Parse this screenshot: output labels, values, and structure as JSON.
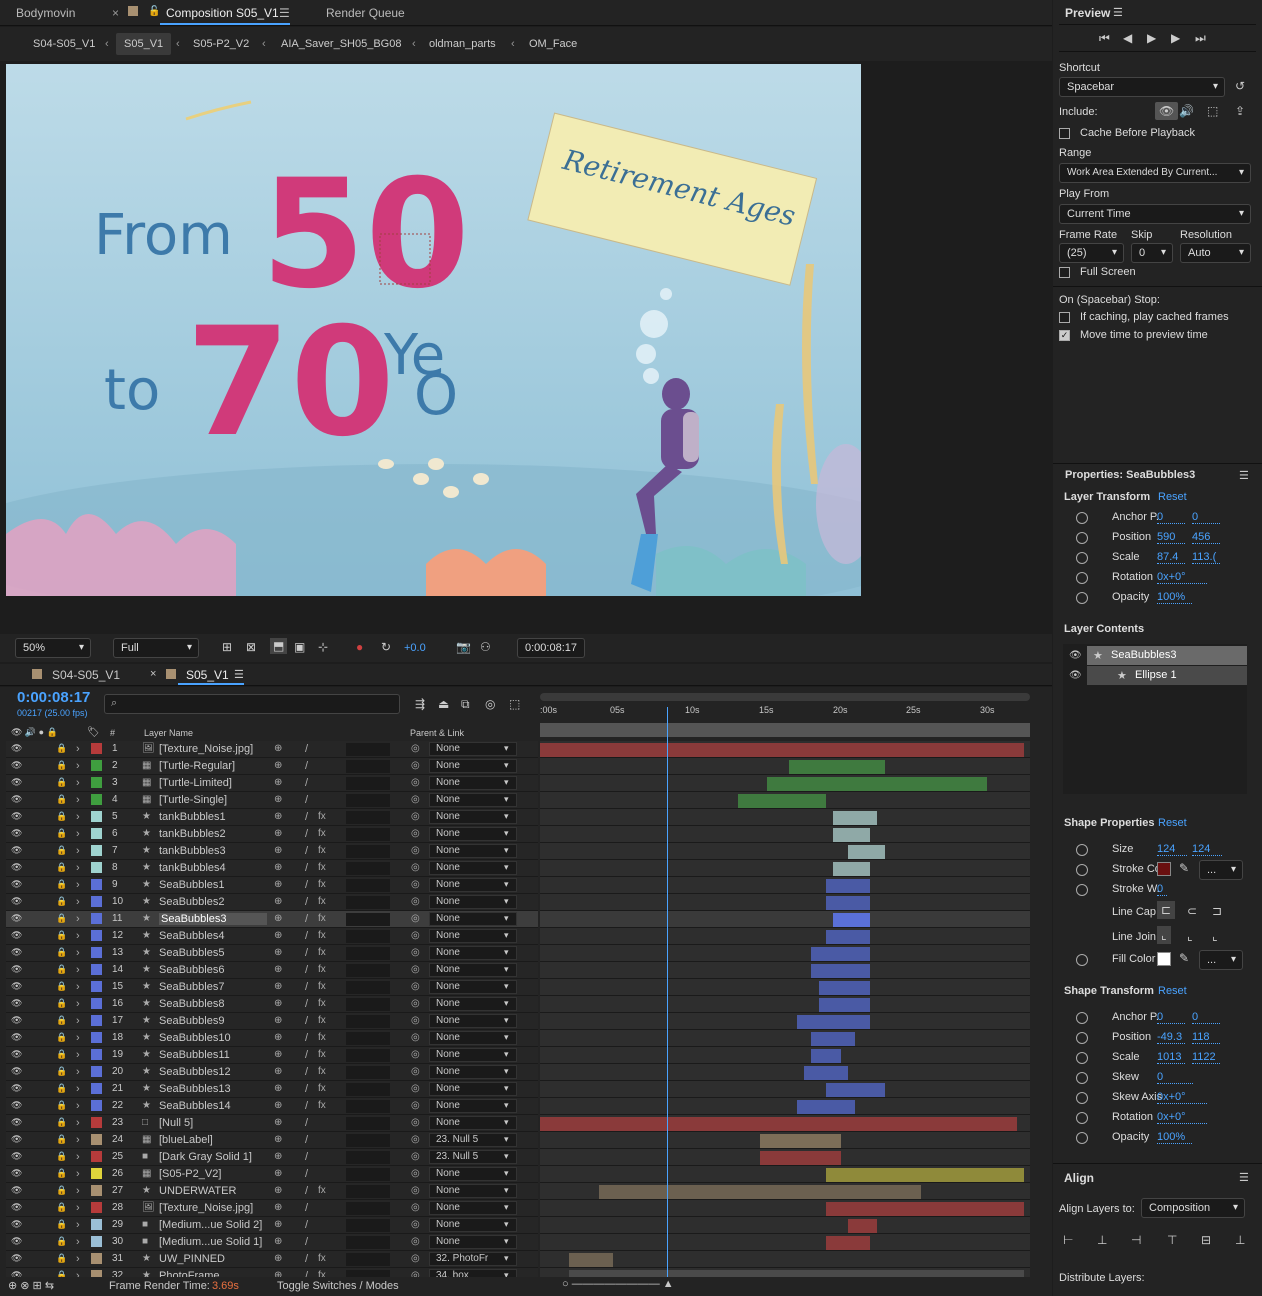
{
  "tabs": {
    "bodymovin": "Bodymovin",
    "close": "×",
    "composition": "Composition S05_V1",
    "menu": "☰",
    "render_queue": "Render Queue"
  },
  "breadcrumbs": [
    "S04-S05_V1",
    "S05_V1",
    "S05-P2_V2",
    "AIA_Saver_SH05_BG08",
    "oldman_parts",
    "OM_Face"
  ],
  "viewer": {
    "from": "From",
    "to": "to",
    "fifty": "50",
    "seventy": "70",
    "ye": "Ye",
    "o": "O",
    "sign": "Retirement Ages"
  },
  "viewer_bar": {
    "zoom": "50%",
    "quality": "Full",
    "exposure": "+0.0",
    "timecode": "0:00:08:17"
  },
  "timeline_tabs": {
    "tab1": "S04-S05_V1",
    "tab2": "S05_V1",
    "close": "×",
    "menu": "☰"
  },
  "timeline": {
    "time": "0:00:08:17",
    "frames": "00217 (25.00 fps)",
    "search_placeholder": "",
    "col_hash": "#",
    "col_layer": "Layer Name",
    "col_parent": "Parent & Link",
    "ticks": [
      ":00s",
      "05s",
      "10s",
      "15s",
      "20s",
      "25s",
      "30s"
    ],
    "frame_render_label": "Frame Render Time:",
    "frame_render_value": "3.69s",
    "toggle": "Toggle Switches / Modes"
  },
  "layers": [
    {
      "n": "1",
      "name": "[Texture_Noise.jpg]",
      "color": "#b63b3b",
      "parent": "None",
      "type": "img"
    },
    {
      "n": "2",
      "name": "[Turtle-Regular]",
      "color": "#3f9e3f",
      "parent": "None",
      "type": "comp"
    },
    {
      "n": "3",
      "name": "[Turtle-Limited]",
      "color": "#3f9e3f",
      "parent": "None",
      "type": "comp"
    },
    {
      "n": "4",
      "name": "[Turtle-Single]",
      "color": "#3f9e3f",
      "parent": "None",
      "type": "comp"
    },
    {
      "n": "5",
      "name": "tankBubbles1",
      "color": "#9fd3cf",
      "parent": "None",
      "type": "shape"
    },
    {
      "n": "6",
      "name": "tankBubbles2",
      "color": "#9fd3cf",
      "parent": "None",
      "type": "shape"
    },
    {
      "n": "7",
      "name": "tankBubbles3",
      "color": "#9fd3cf",
      "parent": "None",
      "type": "shape"
    },
    {
      "n": "8",
      "name": "tankBubbles4",
      "color": "#9fd3cf",
      "parent": "None",
      "type": "shape"
    },
    {
      "n": "9",
      "name": "SeaBubbles1",
      "color": "#5b6fd6",
      "parent": "None",
      "type": "shape"
    },
    {
      "n": "10",
      "name": "SeaBubbles2",
      "color": "#5b6fd6",
      "parent": "None",
      "type": "shape"
    },
    {
      "n": "11",
      "name": "SeaBubbles3",
      "color": "#5b6fd6",
      "parent": "None",
      "type": "shape"
    },
    {
      "n": "12",
      "name": "SeaBubbles4",
      "color": "#5b6fd6",
      "parent": "None",
      "type": "shape"
    },
    {
      "n": "13",
      "name": "SeaBubbles5",
      "color": "#5b6fd6",
      "parent": "None",
      "type": "shape"
    },
    {
      "n": "14",
      "name": "SeaBubbles6",
      "color": "#5b6fd6",
      "parent": "None",
      "type": "shape"
    },
    {
      "n": "15",
      "name": "SeaBubbles7",
      "color": "#5b6fd6",
      "parent": "None",
      "type": "shape"
    },
    {
      "n": "16",
      "name": "SeaBubbles8",
      "color": "#5b6fd6",
      "parent": "None",
      "type": "shape"
    },
    {
      "n": "17",
      "name": "SeaBubbles9",
      "color": "#5b6fd6",
      "parent": "None",
      "type": "shape"
    },
    {
      "n": "18",
      "name": "SeaBubbles10",
      "color": "#5b6fd6",
      "parent": "None",
      "type": "shape"
    },
    {
      "n": "19",
      "name": "SeaBubbles11",
      "color": "#5b6fd6",
      "parent": "None",
      "type": "shape"
    },
    {
      "n": "20",
      "name": "SeaBubbles12",
      "color": "#5b6fd6",
      "parent": "None",
      "type": "shape"
    },
    {
      "n": "21",
      "name": "SeaBubbles13",
      "color": "#5b6fd6",
      "parent": "None",
      "type": "shape"
    },
    {
      "n": "22",
      "name": "SeaBubbles14",
      "color": "#5b6fd6",
      "parent": "None",
      "type": "shape"
    },
    {
      "n": "23",
      "name": "[Null 5]",
      "color": "#b63b3b",
      "parent": "None",
      "type": "null"
    },
    {
      "n": "24",
      "name": "[blueLabel]",
      "color": "#a89071",
      "parent": "23. Null 5",
      "type": "comp"
    },
    {
      "n": "25",
      "name": "[Dark Gray Solid 1]",
      "color": "#b63b3b",
      "parent": "23. Null 5",
      "type": "solid"
    },
    {
      "n": "26",
      "name": "[S05-P2_V2]",
      "color": "#e0d43b",
      "parent": "None",
      "type": "comp"
    },
    {
      "n": "27",
      "name": "UNDERWATER",
      "color": "#a89071",
      "parent": "None",
      "type": "shape"
    },
    {
      "n": "28",
      "name": "[Texture_Noise.jpg]",
      "color": "#b63b3b",
      "parent": "None",
      "type": "img"
    },
    {
      "n": "29",
      "name": "[Medium...ue Solid 2]",
      "color": "#9bbfd6",
      "parent": "None",
      "type": "solid"
    },
    {
      "n": "30",
      "name": "[Medium...ue Solid 1]",
      "color": "#9bbfd6",
      "parent": "None",
      "type": "solid"
    },
    {
      "n": "31",
      "name": "UW_PINNED",
      "color": "#a89071",
      "parent": "32. PhotoFr",
      "type": "shape"
    },
    {
      "n": "32",
      "name": "PhotoFrame",
      "color": "#a89071",
      "parent": "34. box",
      "type": "shape"
    }
  ],
  "bars": [
    {
      "s": 0,
      "e": 33,
      "c": "#8a3a3a"
    },
    {
      "s": 17,
      "e": 23.5,
      "c": "#3f7a3f"
    },
    {
      "s": 15.5,
      "e": 30.5,
      "c": "#3f7a3f"
    },
    {
      "s": 13.5,
      "e": 19.5,
      "c": "#3f7a3f"
    },
    {
      "s": 20,
      "e": 23,
      "c": "#8fa9a7"
    },
    {
      "s": 20,
      "e": 22.5,
      "c": "#8fa9a7"
    },
    {
      "s": 21,
      "e": 23.5,
      "c": "#8fa9a7"
    },
    {
      "s": 20,
      "e": 22.5,
      "c": "#8fa9a7"
    },
    {
      "s": 19.5,
      "e": 22.5,
      "c": "#4a5aa5"
    },
    {
      "s": 19.5,
      "e": 22.5,
      "c": "#4a5aa5"
    },
    {
      "s": 20,
      "e": 22.5,
      "c": "#5a70d8"
    },
    {
      "s": 19.5,
      "e": 22.5,
      "c": "#4a5aa5"
    },
    {
      "s": 18.5,
      "e": 22.5,
      "c": "#4a5aa5"
    },
    {
      "s": 18.5,
      "e": 22.5,
      "c": "#4a5aa5"
    },
    {
      "s": 19,
      "e": 22.5,
      "c": "#4a5aa5"
    },
    {
      "s": 19,
      "e": 22.5,
      "c": "#4a5aa5"
    },
    {
      "s": 17.5,
      "e": 22.5,
      "c": "#4a5aa5"
    },
    {
      "s": 18.5,
      "e": 21.5,
      "c": "#4a5aa5"
    },
    {
      "s": 18.5,
      "e": 20.5,
      "c": "#4a5aa5"
    },
    {
      "s": 18,
      "e": 21,
      "c": "#4a5aa5"
    },
    {
      "s": 19.5,
      "e": 23.5,
      "c": "#4a5aa5"
    },
    {
      "s": 17.5,
      "e": 21.5,
      "c": "#4a5aa5"
    },
    {
      "s": 0,
      "e": 32.5,
      "c": "#8a3a3a"
    },
    {
      "s": 15,
      "e": 20.5,
      "c": "#7d6e58"
    },
    {
      "s": 15,
      "e": 20.5,
      "c": "#8a3a3a"
    },
    {
      "s": 19.5,
      "e": 33,
      "c": "#8f8a3a"
    },
    {
      "s": 4,
      "e": 26,
      "c": "#6b6050"
    },
    {
      "s": 19.5,
      "e": 33,
      "c": "#8a3a3a"
    },
    {
      "s": 21,
      "e": 23,
      "c": "#8a3a3a"
    },
    {
      "s": 19.5,
      "e": 22.5,
      "c": "#8a3a3a"
    },
    {
      "s": 2,
      "e": 5,
      "c": "#6b6050"
    },
    {
      "s": 2,
      "e": 33,
      "c": "#4a4a4a"
    }
  ],
  "current_time_sec": 8.68,
  "preview": {
    "title": "Preview",
    "menu": "☰",
    "shortcut_label": "Shortcut",
    "shortcut": "Spacebar",
    "include": "Include:",
    "cache": "Cache Before Playback",
    "range_label": "Range",
    "range": "Work Area Extended By Current...",
    "playfrom_label": "Play From",
    "playfrom": "Current Time",
    "framerate_label": "Frame Rate",
    "skip_label": "Skip",
    "res_label": "Resolution",
    "framerate": "(25)",
    "skip": "0",
    "res": "Auto",
    "fullscreen": "Full Screen",
    "stop_label": "On (Spacebar) Stop:",
    "opt1": "If caching, play cached frames",
    "opt2": "Move time to preview time"
  },
  "properties": {
    "title": "Properties: SeaBubbles3",
    "menu": "☰",
    "layer_transform": "Layer Transform",
    "reset": "Reset",
    "anchor": "Anchor P.",
    "anchor_x": "0",
    "anchor_y": "0",
    "position": "Position",
    "pos_x": "590",
    "pos_y": "456",
    "scale": "Scale",
    "scale_x": "87.4",
    "scale_y": "113.(",
    "rotation": "Rotation",
    "rot": "0x+0°",
    "opacity": "Opacity",
    "op": "100%",
    "layer_contents": "Layer Contents",
    "c1": "SeaBubbles3",
    "c2": "Ellipse 1",
    "shape_props": "Shape Properties",
    "size": "Size",
    "size_x": "124",
    "size_y": "124",
    "stroke_color": "Stroke Co",
    "stroke_w": "Stroke W.",
    "stroke_w_v": "0",
    "line_cap": "Line Cap",
    "line_join": "Line Join",
    "fill_color": "Fill Color",
    "dots": "...",
    "shape_transform": "Shape Transform",
    "s_anchor_x": "0",
    "s_anchor_y": "0",
    "s_pos_x": "-49.3",
    "s_pos_y": "118",
    "s_scale_x": "1013",
    "s_scale_y": "1122",
    "skew": "Skew",
    "skew_v": "0",
    "skew_axis": "Skew Axis",
    "skew_axis_v": "0x+0°",
    "s_rot": "0x+0°",
    "s_op": "100%"
  },
  "align": {
    "title": "Align",
    "menu": "☰",
    "to_label": "Align Layers to:",
    "to": "Composition",
    "distribute": "Distribute Layers:"
  },
  "colors": {
    "accent": "#4aa3ff",
    "selected_bar": "#5a70d8"
  }
}
